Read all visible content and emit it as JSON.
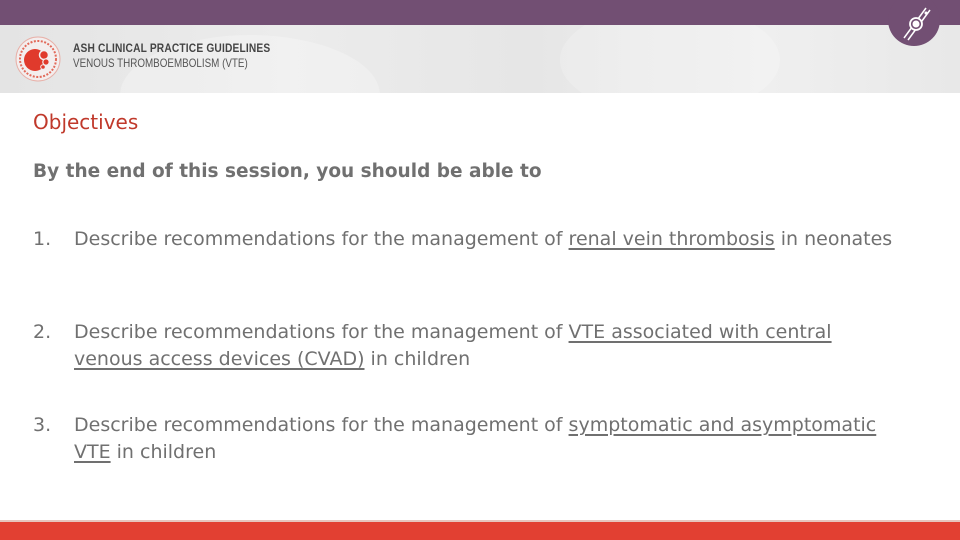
{
  "header": {
    "org_bold": "ASH CLINICAL PRACTICE GUIDELINES",
    "subtitle": "VENOUS THROMBOEMBOLISM (VTE)",
    "logo_icon": "ash-society-seal-icon",
    "badge_icon": "vein-catheter-icon"
  },
  "colors": {
    "top_bar": "#724f73",
    "title": "#c0392b",
    "body_text": "#707070",
    "footer_bar": "#e24032"
  },
  "slide": {
    "title": "Objectives",
    "intro": "By the end of this session, you should be able to",
    "objectives": [
      {
        "number": "1.",
        "prefix": "Describe recommendations for the management of ",
        "emphasis": "renal vein thrombosis",
        "suffix": " in neonates"
      },
      {
        "number": "2.",
        "prefix": "Describe recommendations for the management of ",
        "emphasis": "VTE associated with central venous access devices (CVAD)",
        "suffix": " in children"
      },
      {
        "number": "3.",
        "prefix": "Describe recommendations for the management of ",
        "emphasis": "symptomatic and asymptomatic VTE",
        "suffix": " in children"
      }
    ]
  }
}
